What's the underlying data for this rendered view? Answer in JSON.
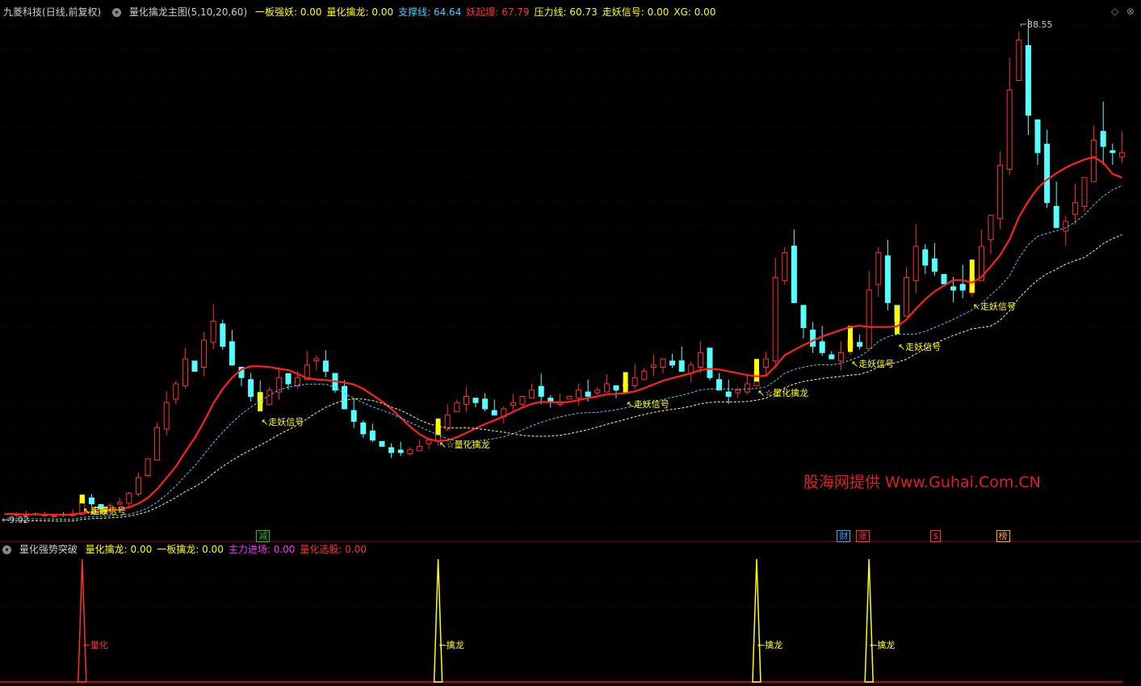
{
  "header": {
    "stock": "九菱科技",
    "period": "(日线,前复权)",
    "indicator": "量化擒龙主图",
    "params": "(5,10,20,60)",
    "fields": [
      {
        "label": "一板强妖:",
        "value": "0.00",
        "color": "#ffff00"
      },
      {
        "label": "量化擒龙:",
        "value": "0.00",
        "color": "#ffff00"
      },
      {
        "label": "支撑线:",
        "value": "64.64",
        "color": "#3fd0ff"
      },
      {
        "label": "妖起爆:",
        "value": "67.79",
        "color": "#ff3030"
      },
      {
        "label": "压力线:",
        "value": "60.73",
        "color": "#ffff00"
      },
      {
        "label": "走妖信号:",
        "value": "0.00",
        "color": "#ffff00"
      },
      {
        "label": "XG:",
        "value": "0.00",
        "color": "#ffff00"
      }
    ]
  },
  "sub_header": {
    "indicator": "量化强势突破",
    "fields": [
      {
        "label": "量化擒龙:",
        "value": "0.00",
        "color": "#ffff00"
      },
      {
        "label": "一板擒龙:",
        "value": "0.00",
        "color": "#ffff00"
      },
      {
        "label": "主力进场:",
        "value": "0.00",
        "color": "#ff30ff"
      },
      {
        "label": "量化选股:",
        "value": "0.00",
        "color": "#ff3030"
      }
    ]
  },
  "price_labels": {
    "high": "88.55",
    "low": "9.02"
  },
  "signals": [
    {
      "text": "走妖信号",
      "color": "#ffff00",
      "idx": 8
    },
    {
      "text": "起爆",
      "color": "#ffff00",
      "idx": 8
    },
    {
      "text": "走妖信号",
      "color": "#ffff00",
      "idx": 27
    },
    {
      "text": "☆量化擒龙",
      "color": "#ffff00",
      "idx": 46
    },
    {
      "text": "走妖信号",
      "color": "#ffff00",
      "idx": 66
    },
    {
      "text": "☆量化擒龙",
      "color": "#ffff00",
      "idx": 80
    },
    {
      "text": "走妖信号",
      "color": "#ffff00",
      "idx": 90
    },
    {
      "text": "走妖信号",
      "color": "#ffff00",
      "idx": 95
    },
    {
      "text": "走妖信号",
      "color": "#ffff00",
      "idx": 103
    }
  ],
  "event_markers": [
    {
      "text": "减",
      "color": "#20c020",
      "idx": 27
    },
    {
      "text": "财",
      "color": "#3fa0ff",
      "idx": 89
    },
    {
      "text": "涨",
      "color": "#ff3030",
      "idx": 91
    },
    {
      "text": "$",
      "color": "#ff3030",
      "idx": 99
    },
    {
      "text": "榜",
      "color": "#ffa030",
      "idx": 106
    }
  ],
  "sub_peaks": [
    {
      "text": "←量化",
      "color": "#ff3030",
      "idx": 8
    },
    {
      "text": "←擒龙",
      "color": "#ffff00",
      "idx": 46
    },
    {
      "text": "←擒龙",
      "color": "#ffff00",
      "idx": 80
    },
    {
      "text": "←擒龙",
      "color": "#ffff00",
      "idx": 92
    }
  ],
  "watermark": "股海网提供 Www.Guhai.Com.CN",
  "colors": {
    "up": "#ff3030",
    "down": "#54ffff",
    "ma_red": "#ff2020",
    "support": "#3fd0ff",
    "pressure": "#ffff60"
  },
  "chart_data": {
    "type": "candlestick",
    "y_range": [
      9.02,
      88.55
    ],
    "closes": [
      10.2,
      10.1,
      10.0,
      10.1,
      10.0,
      9.9,
      10.0,
      10.2,
      12.5,
      11.8,
      11.0,
      11.5,
      12.0,
      13.5,
      16,
      19,
      24,
      28,
      31,
      35,
      33,
      38,
      41,
      37,
      34,
      32,
      29,
      28,
      30,
      32,
      31,
      32,
      34,
      35,
      33,
      30,
      27,
      25,
      23,
      22,
      21,
      20,
      20,
      20.5,
      21,
      22,
      24,
      26,
      28,
      29,
      28,
      27,
      26,
      27,
      28,
      29,
      30,
      29,
      28,
      28,
      29,
      30,
      29,
      30,
      31,
      30,
      31,
      32,
      33,
      34,
      35,
      34,
      33,
      34,
      36,
      32,
      30,
      29,
      30,
      31,
      33,
      35,
      48,
      52,
      44,
      40,
      37,
      36,
      35,
      36,
      38,
      37,
      46,
      52,
      44,
      41,
      48,
      53,
      50,
      49,
      47,
      46,
      46,
      48,
      53,
      58,
      66,
      78,
      86,
      74,
      68,
      60,
      56,
      57,
      60,
      64,
      70,
      69,
      68,
      68
    ]
  }
}
